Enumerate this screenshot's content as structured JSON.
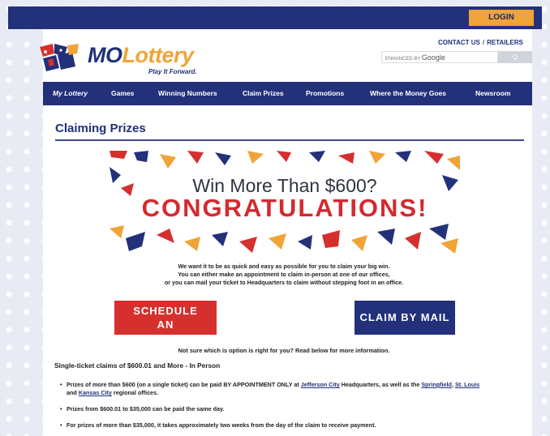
{
  "header": {
    "login_label": "LOGIN",
    "logo_text_mo": "MO",
    "logo_text_lottery": "Lottery",
    "logo_tagline": "Play It Forward.",
    "contact_label": "CONTACT US",
    "separator": "/",
    "retailers_label": "RETAILERS",
    "search_prefix": "ENHANCED BY",
    "search_brand": "Google",
    "search_button": "Q"
  },
  "nav": {
    "items": [
      "My Lottery",
      "Games",
      "Winning Numbers",
      "Claim Prizes",
      "Promotions",
      "Where the Money Goes",
      "Newsroom"
    ]
  },
  "page": {
    "title": "Claiming Prizes",
    "banner_sub": "Win More Than $600?",
    "banner_big": "CONGRATULATIONS!",
    "intro_line1": "We want it to be as quick and easy as possible for you to claim your big win.",
    "intro_line2": "You can either make an appointment to claim in-person at one of our offices,",
    "intro_line3": "or you can mail your ticket to Headquarters to claim without stepping foot in an office.",
    "schedule_line1": "SCHEDULE",
    "schedule_line2": "AN APPOINTMENT",
    "mail_label": "CLAIM BY MAIL",
    "not_sure": "Not sure which is option is right for you? Read below for more information.",
    "section_heading": "Single-ticket claims of $600.01 and More - In Person",
    "bullet1_a": "Prizes of more than $600 (on a single ticket) can be paid BY APPOINTMENT ONLY at ",
    "bullet1_link1": "Jefferson City",
    "bullet1_b": " Headquarters, as well as the ",
    "bullet1_link2": "Springfield",
    "bullet1_c": ", ",
    "bullet1_link3": "St. Louis",
    "bullet1_d": "and ",
    "bullet1_link4": "Kansas City",
    "bullet1_e": " regional offices.",
    "bullet2": "Prizes from $600.01 to $35,000 can be paid the same day.",
    "bullet3": "For prizes of more than $35,000, it takes approximately two weeks from the day of the claim to receive payment."
  },
  "colors": {
    "navy": "#23317a",
    "gold": "#f0a437",
    "red": "#d5302d"
  }
}
